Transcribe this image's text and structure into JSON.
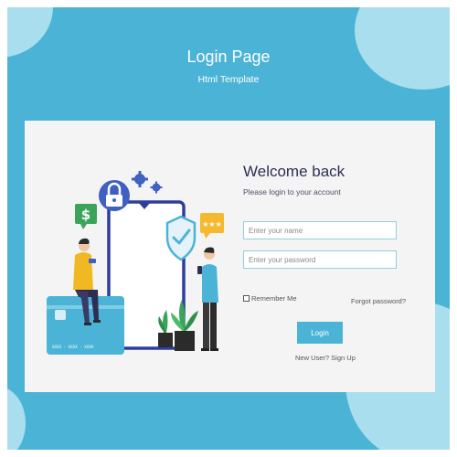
{
  "header": {
    "title": "Login Page",
    "subtitle": "Html Template"
  },
  "login": {
    "heading": "Welcome back",
    "subheading": "Please login to your account",
    "name_placeholder": "Enter your name",
    "password_placeholder": "Enter your password",
    "remember_label": "Remember Me",
    "forgot_label": "Forgot password?",
    "login_label": "Login",
    "signup_label": "New User? Sign Up"
  },
  "illustration": {
    "card_number": "XXXX - XXXX - XXXX",
    "icons": [
      "padlock-icon",
      "gear-icon",
      "dollar-chat-icon",
      "shield-check-icon",
      "star-rating-chat-icon",
      "credit-card-icon",
      "potted-plant-icon"
    ]
  },
  "colors": {
    "brand": "#4bb4d6",
    "heading": "#2e2e55",
    "card_background": "#f4f4f4",
    "accent_blue": "#3f5fc2",
    "accent_green": "#3aa55a",
    "accent_yellow": "#f5b82e"
  }
}
